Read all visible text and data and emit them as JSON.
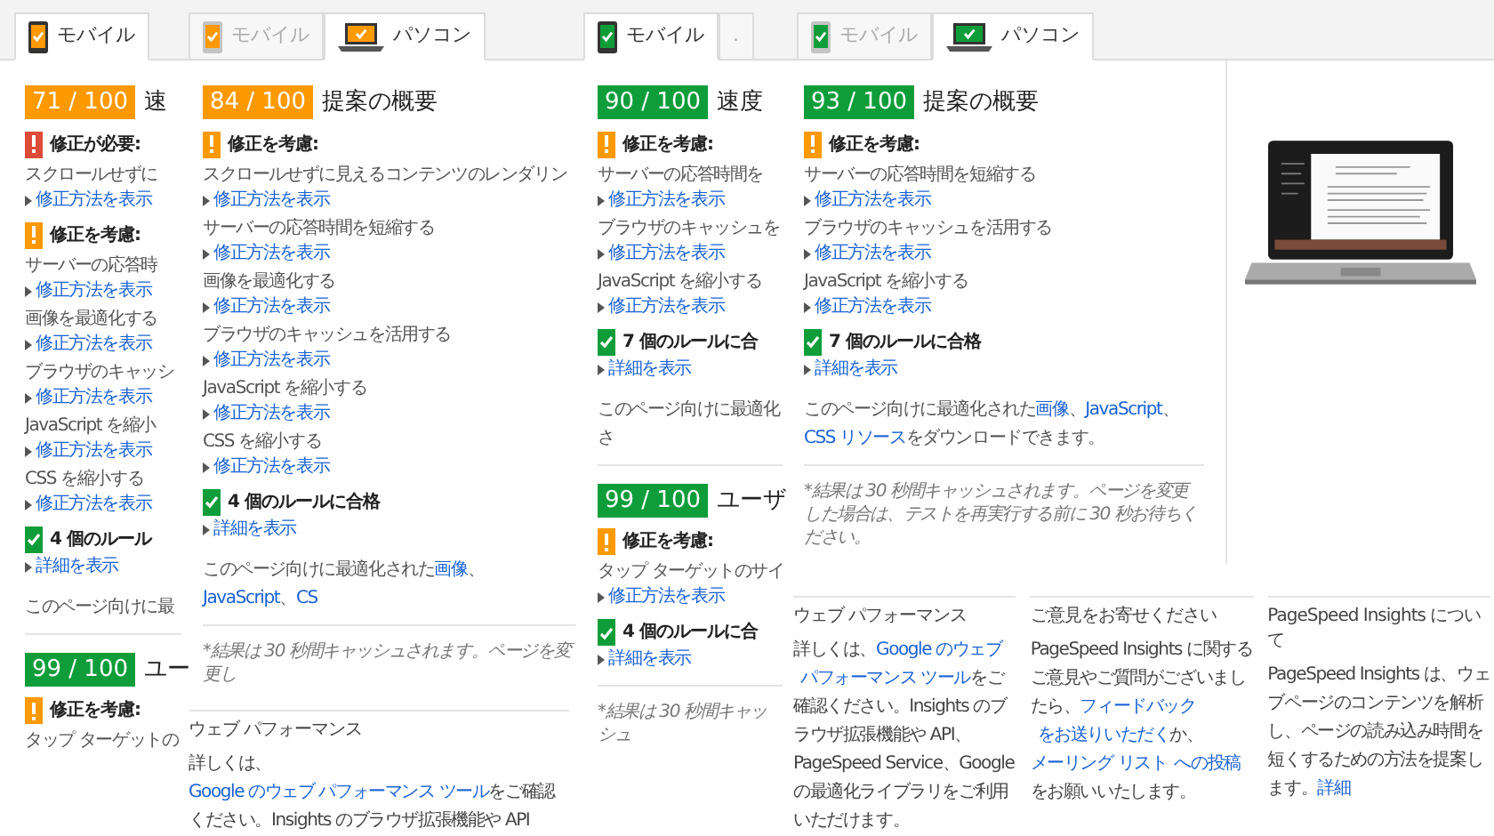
{
  "panels": [
    {
      "tabs": [
        {
          "label": "モバイル",
          "kind": "mobile",
          "color": "#ff9900",
          "selected": true
        }
      ],
      "items": [
        {
          "kind": "score",
          "color": "#ff9900",
          "score": "71 / 100",
          "title": "速"
        },
        {
          "kind": "fix",
          "text": "修正が必要:"
        },
        {
          "kind": "rule",
          "text": "スクロールせずに"
        },
        {
          "kind": "link",
          "text": "修正方法を表示"
        },
        {
          "kind": "consider",
          "text": "修正を考慮:"
        },
        {
          "kind": "rule",
          "text": "サーバーの応答時"
        },
        {
          "kind": "link",
          "text": "修正方法を表示"
        },
        {
          "kind": "rule",
          "text": "画像を最適化する"
        },
        {
          "kind": "link",
          "text": "修正方法を表示"
        },
        {
          "kind": "rule",
          "text": "ブラウザのキャッシ"
        },
        {
          "kind": "link",
          "text": "修正方法を表示"
        },
        {
          "kind": "rule",
          "text": "JavaScript を縮小"
        },
        {
          "kind": "link",
          "text": "修正方法を表示"
        },
        {
          "kind": "rule",
          "text": "CSS を縮小する"
        },
        {
          "kind": "link",
          "text": "修正方法を表示"
        },
        {
          "kind": "pass",
          "text": "4 個のルール"
        },
        {
          "kind": "link",
          "text": "詳細を表示"
        },
        {
          "kind": "note",
          "parts": [
            {
              "text": "このページ向けに最",
              "link": false
            }
          ]
        },
        {
          "kind": "score",
          "color": "#0f9d3a",
          "score": "99 / 100",
          "title": "ユー"
        },
        {
          "kind": "consider",
          "text": "修正を考慮:"
        },
        {
          "kind": "rule",
          "text": "タップ ターゲットの"
        }
      ]
    },
    {
      "tabs": [
        {
          "label": "モバイル",
          "kind": "mobile",
          "color": "#ff9900",
          "selected": false
        },
        {
          "label": "パソコン",
          "kind": "laptop",
          "color": "#ff9900",
          "selected": true
        }
      ],
      "items": [
        {
          "kind": "score",
          "color": "#ff9900",
          "score": "84 / 100",
          "title": "提案の概要"
        },
        {
          "kind": "consider",
          "text": "修正を考慮:"
        },
        {
          "kind": "rule",
          "text": "スクロールせずに見えるコンテンツのレンダリン"
        },
        {
          "kind": "link",
          "text": "修正方法を表示"
        },
        {
          "kind": "rule",
          "text": "サーバーの応答時間を短縮する"
        },
        {
          "kind": "link",
          "text": "修正方法を表示"
        },
        {
          "kind": "rule",
          "text": "画像を最適化する"
        },
        {
          "kind": "link",
          "text": "修正方法を表示"
        },
        {
          "kind": "rule",
          "text": "ブラウザのキャッシュを活用する"
        },
        {
          "kind": "link",
          "text": "修正方法を表示"
        },
        {
          "kind": "rule",
          "text": "JavaScript を縮小する"
        },
        {
          "kind": "link",
          "text": "修正方法を表示"
        },
        {
          "kind": "rule",
          "text": "CSS を縮小する"
        },
        {
          "kind": "link",
          "text": "修正方法を表示"
        },
        {
          "kind": "pass",
          "text": "4 個のルールに合格"
        },
        {
          "kind": "link",
          "text": "詳細を表示"
        },
        {
          "kind": "note",
          "parts": [
            {
              "text": "このページ向けに最適化された",
              "link": false
            },
            {
              "text": "画像",
              "link": true
            },
            {
              "text": "、",
              "link": false
            },
            {
              "text": "JavaScript",
              "link": true
            },
            {
              "text": "、",
              "link": false
            },
            {
              "text": "CS",
              "link": true
            }
          ]
        },
        {
          "kind": "cache",
          "text": "*結果は 30 秒間キャッシュされます。ページを変更し"
        }
      ],
      "footer": [
        {
          "title": "ウェブ パフォーマンス",
          "parts": [
            {
              "text": "詳しくは、",
              "link": false
            },
            {
              "text": "Google のウェブ パフォーマンス ツール",
              "link": true
            },
            {
              "text": "をご確認ください。Insights のブラウザ拡張機能や API",
              "link": false
            }
          ]
        }
      ]
    },
    {
      "tabs": [
        {
          "label": "モバイル",
          "kind": "mobile",
          "color": "#0f9d3a",
          "selected": true
        },
        {
          "label": ".",
          "selected": false
        }
      ],
      "items": [
        {
          "kind": "score",
          "color": "#0f9d3a",
          "score": "90 / 100",
          "title": "速度"
        },
        {
          "kind": "consider",
          "text": "修正を考慮:"
        },
        {
          "kind": "rule",
          "text": "サーバーの応答時間を"
        },
        {
          "kind": "link",
          "text": "修正方法を表示"
        },
        {
          "kind": "rule",
          "text": "ブラウザのキャッシュを"
        },
        {
          "kind": "link",
          "text": "修正方法を表示"
        },
        {
          "kind": "rule",
          "text": "JavaScript を縮小する"
        },
        {
          "kind": "link",
          "text": "修正方法を表示"
        },
        {
          "kind": "pass",
          "text": "7 個のルールに合"
        },
        {
          "kind": "link",
          "text": "詳細を表示"
        },
        {
          "kind": "note",
          "parts": [
            {
              "text": "このページ向けに最適化さ",
              "link": false
            }
          ]
        },
        {
          "kind": "score",
          "color": "#0f9d3a",
          "score": "99 / 100",
          "title": "ユーザ"
        },
        {
          "kind": "consider",
          "text": "修正を考慮:"
        },
        {
          "kind": "rule",
          "text": "タップ ターゲットのサイ"
        },
        {
          "kind": "link",
          "text": "修正方法を表示"
        },
        {
          "kind": "pass",
          "text": "4 個のルールに合"
        },
        {
          "kind": "link",
          "text": "詳細を表示"
        },
        {
          "kind": "cache",
          "text": "*結果は 30 秒間キャッシュ"
        }
      ]
    },
    {
      "tabs": [
        {
          "label": "モバイル",
          "kind": "mobile",
          "color": "#0f9d3a",
          "selected": false
        },
        {
          "label": "パソコン",
          "kind": "laptop",
          "color": "#0f9d3a",
          "selected": true
        }
      ],
      "preview": true,
      "items": [
        {
          "kind": "score",
          "color": "#0f9d3a",
          "score": "93 / 100",
          "title": "提案の概要"
        },
        {
          "kind": "consider",
          "text": "修正を考慮:"
        },
        {
          "kind": "rule",
          "text": "サーバーの応答時間を短縮する"
        },
        {
          "kind": "link",
          "text": "修正方法を表示"
        },
        {
          "kind": "rule",
          "text": "ブラウザのキャッシュを活用する"
        },
        {
          "kind": "link",
          "text": "修正方法を表示"
        },
        {
          "kind": "rule",
          "text": "JavaScript を縮小する"
        },
        {
          "kind": "link",
          "text": "修正方法を表示"
        },
        {
          "kind": "pass",
          "text": "7 個のルールに合格"
        },
        {
          "kind": "link",
          "text": "詳細を表示"
        },
        {
          "kind": "note",
          "parts": [
            {
              "text": "このページ向けに最適化された",
              "link": false
            },
            {
              "text": "画像",
              "link": true
            },
            {
              "text": "、",
              "link": false
            },
            {
              "text": "JavaScript",
              "link": true
            },
            {
              "text": "、",
              "link": false
            },
            {
              "text": "CSS リソース",
              "link": true
            },
            {
              "text": "をダウンロードできます。",
              "link": false
            }
          ]
        },
        {
          "kind": "cache",
          "text": "*結果は 30 秒間キャッシュされます。ページを変更した場合は、テストを再実行する前に 30 秒お待ちください。"
        }
      ],
      "footer": [
        {
          "title": "ウェブ パフォーマンス",
          "parts": [
            {
              "text": "詳しくは、",
              "link": false
            },
            {
              "text": "Google のウェブ",
              "link": true
            },
            {
              "text": "パフォーマンス ツール",
              "link": true
            },
            {
              "text": "をご確認ください。Insights のブラウザ拡張機能や API、PageSpeed Service、Google の最適化ライブラリをご利用いただけます。",
              "link": false
            }
          ]
        },
        {
          "title": "ご意見をお寄せください",
          "parts": [
            {
              "text": "PageSpeed Insights に関するご意見やご質問がございましたら、",
              "link": false
            },
            {
              "text": "フィードバック",
              "link": true
            },
            {
              "text": "をお送りいただく",
              "link": true
            },
            {
              "text": "か、",
              "link": false
            },
            {
              "text": "メーリング リスト",
              "link": true
            },
            {
              "text": "への投稿",
              "link": true
            },
            {
              "text": "をお願いいたします。",
              "link": false
            }
          ]
        },
        {
          "title": "PageSpeed Insights について",
          "parts": [
            {
              "text": "PageSpeed Insights は、ウェブページのコンテンツを解析し、ページの読み込み時間を短くするための方法を提案します。",
              "link": false
            },
            {
              "text": "詳細",
              "link": true
            }
          ]
        }
      ]
    }
  ]
}
